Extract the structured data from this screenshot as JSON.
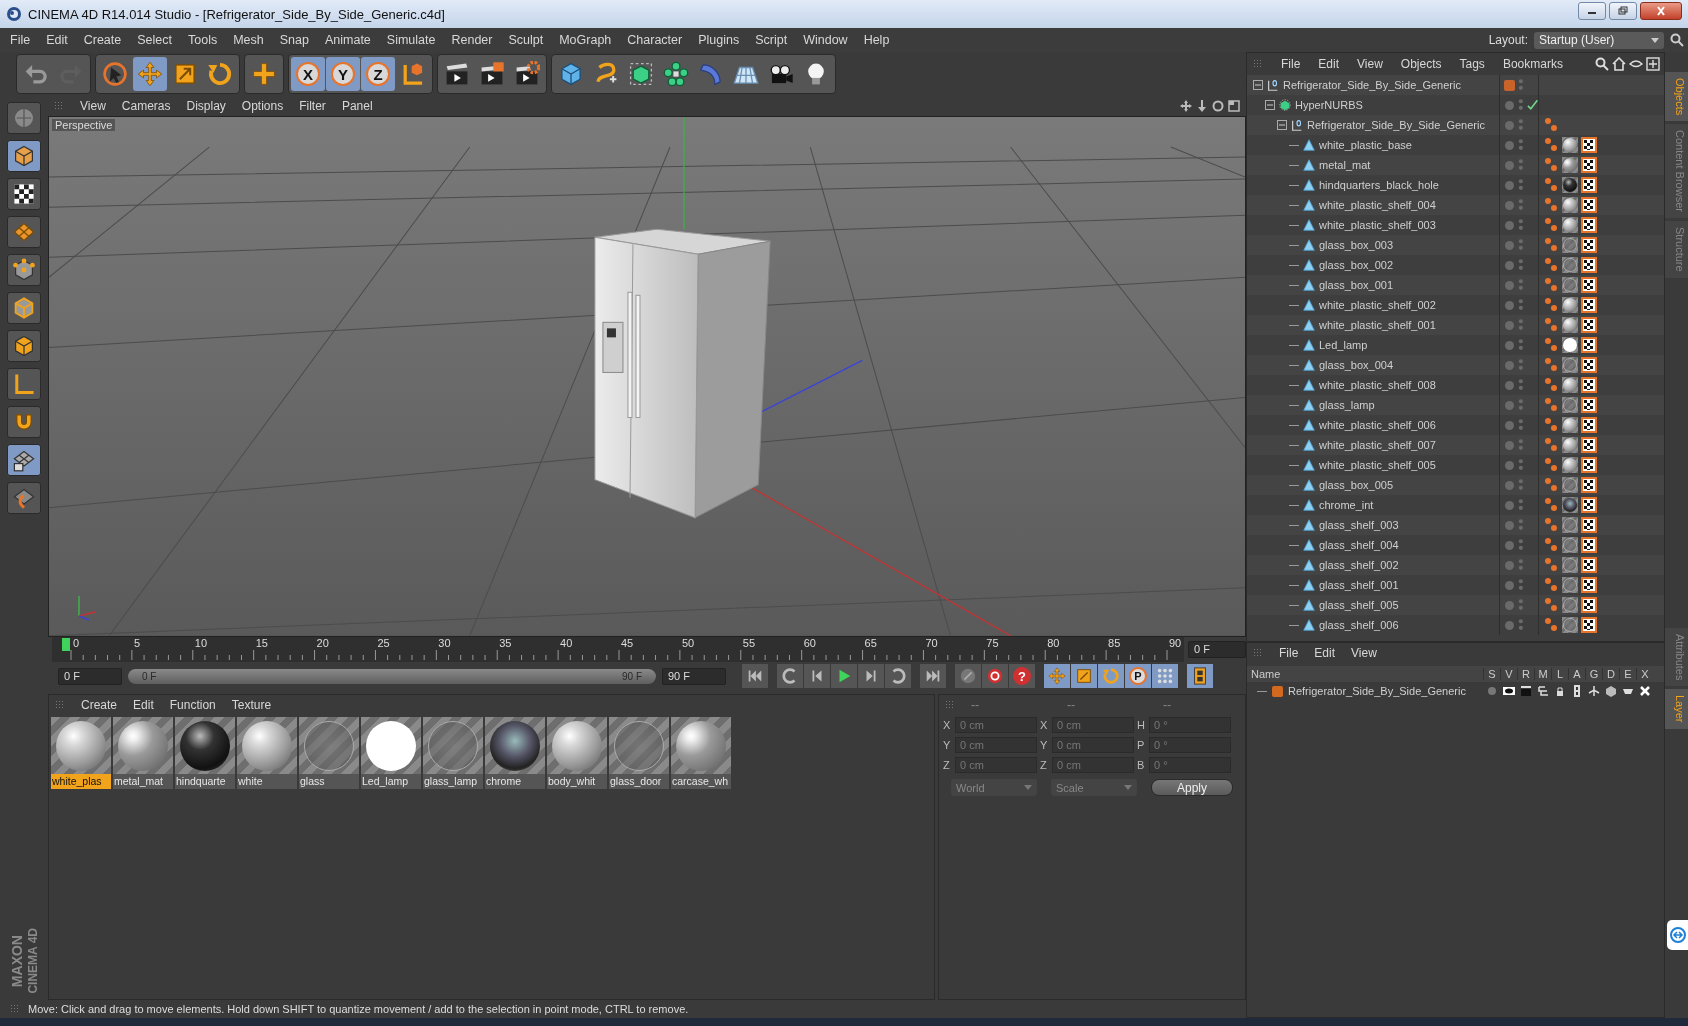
{
  "window": {
    "title": "CINEMA 4D R14.014 Studio - [Refrigerator_Side_By_Side_Generic.c4d]"
  },
  "menu": [
    "File",
    "Edit",
    "Create",
    "Select",
    "Tools",
    "Mesh",
    "Snap",
    "Animate",
    "Simulate",
    "Render",
    "Sculpt",
    "MoGraph",
    "Character",
    "Plugins",
    "Script",
    "Window",
    "Help"
  ],
  "layout": {
    "label": "Layout:",
    "value": "Startup (User)"
  },
  "toolbar": [
    [
      {
        "kind": "undo",
        "selected": false
      },
      {
        "kind": "redo",
        "selected": false
      }
    ],
    [
      {
        "kind": "select",
        "selected": false
      },
      {
        "kind": "move",
        "selected": true
      },
      {
        "kind": "scale",
        "selected": false
      },
      {
        "kind": "rotate",
        "selected": false
      }
    ],
    [
      {
        "kind": "add",
        "selected": false
      }
    ],
    [
      {
        "kind": "axis",
        "label": "X",
        "selected": true
      },
      {
        "kind": "axis",
        "label": "Y",
        "selected": true
      },
      {
        "kind": "axis",
        "label": "Z",
        "selected": true
      },
      {
        "kind": "world",
        "selected": false
      }
    ],
    [
      {
        "kind": "render-view",
        "selected": false
      },
      {
        "kind": "render-picture",
        "selected": false
      },
      {
        "kind": "render-settings",
        "selected": false
      }
    ],
    [
      {
        "kind": "cube",
        "selected": false
      },
      {
        "kind": "spline",
        "selected": false
      },
      {
        "kind": "nurbs",
        "selected": false
      },
      {
        "kind": "array",
        "selected": false
      },
      {
        "kind": "deformer",
        "selected": false
      },
      {
        "kind": "floor",
        "selected": false
      },
      {
        "kind": "camera",
        "selected": false
      },
      {
        "kind": "light",
        "selected": false
      }
    ]
  ],
  "left_toolbar": [
    {
      "kind": "model",
      "selected": false
    },
    {
      "kind": "object",
      "selected": true
    },
    {
      "kind": "texture",
      "selected": false
    },
    {
      "kind": "workplane",
      "selected": false
    },
    {
      "kind": "points",
      "selected": false
    },
    {
      "kind": "edges",
      "selected": false
    },
    {
      "kind": "polygons",
      "selected": false
    },
    {
      "kind": "axis-l",
      "selected": false
    },
    {
      "kind": "magnet",
      "selected": false
    },
    {
      "kind": "grid-lock",
      "selected": true
    },
    {
      "kind": "snap",
      "selected": false
    }
  ],
  "brand": [
    "MAXON",
    "CINEMA 4D"
  ],
  "viewport": {
    "menu": [
      "View",
      "Cameras",
      "Display",
      "Options",
      "Filter",
      "Panel"
    ],
    "view_name": "Perspective"
  },
  "timeline": {
    "ticks": [
      "0",
      "5",
      "10",
      "15",
      "20",
      "25",
      "30",
      "35",
      "40",
      "45",
      "50",
      "55",
      "60",
      "65",
      "70",
      "75",
      "80",
      "85",
      "90"
    ],
    "playhead": {
      "level": 0
    },
    "current_frame": "0 F"
  },
  "playback": {
    "start_field": "0 F",
    "range": {
      "start": "0 F",
      "end": "90 F",
      "level": 1
    },
    "end_field": "90 F",
    "buttons": [
      {
        "kind": "goto-start",
        "selected": false
      },
      {
        "kind": "record-key",
        "selected": false
      },
      {
        "kind": "prev",
        "selected": false
      },
      {
        "kind": "play",
        "selected": false
      },
      {
        "kind": "next",
        "selected": false
      },
      {
        "kind": "loop",
        "selected": false
      },
      {
        "kind": "goto-end",
        "selected": false
      },
      {
        "kind": "key-off",
        "selected": false
      },
      {
        "kind": "record",
        "selected": false
      },
      {
        "kind": "help",
        "label": "?",
        "selected": false
      },
      {
        "kind": "key-move",
        "selected": true
      },
      {
        "kind": "key-scale",
        "selected": true
      },
      {
        "kind": "key-rotate",
        "selected": true
      },
      {
        "kind": "key-param",
        "label": "P",
        "selected": true
      },
      {
        "kind": "key-points",
        "selected": true
      },
      {
        "kind": "timeline-film",
        "selected": true
      }
    ]
  },
  "materials": {
    "menu": [
      "Create",
      "Edit",
      "Function",
      "Texture"
    ],
    "items": [
      {
        "name": "white_plas",
        "kind": "plastic",
        "selected": true
      },
      {
        "name": "metal_mat",
        "kind": "metal",
        "selected": false
      },
      {
        "name": "hindquarte",
        "kind": "dark",
        "selected": false
      },
      {
        "name": "white",
        "kind": "plastic",
        "selected": false
      },
      {
        "name": "glass",
        "kind": "glass",
        "selected": false
      },
      {
        "name": "Led_lamp",
        "kind": "white",
        "selected": false
      },
      {
        "name": "glass_lamp",
        "kind": "glass",
        "selected": false
      },
      {
        "name": "chrome",
        "kind": "chrome",
        "selected": false
      },
      {
        "name": "body_whit",
        "kind": "plastic",
        "selected": false
      },
      {
        "name": "glass_door",
        "kind": "glass",
        "selected": false
      },
      {
        "name": "carcase_wh",
        "kind": "metal",
        "selected": false
      }
    ]
  },
  "coordinates": {
    "headers": [
      "--",
      "--",
      "--"
    ],
    "rows": [
      {
        "axis": "X",
        "position": "0 cm",
        "size_axis": "X",
        "size": "0 cm",
        "rotation_axis": "H",
        "rotation": "0 °"
      },
      {
        "axis": "Y",
        "position": "0 cm",
        "size_axis": "Y",
        "size": "0 cm",
        "rotation_axis": "P",
        "rotation": "0 °"
      },
      {
        "axis": "Z",
        "position": "0 cm",
        "size_axis": "Z",
        "size": "0 cm",
        "rotation_axis": "B",
        "rotation": "0 °"
      }
    ],
    "mode": "World",
    "size_mode": "Scale",
    "apply": "Apply"
  },
  "objects": {
    "menu": [
      "File",
      "Edit",
      "View",
      "Objects",
      "Tags",
      "Bookmarks"
    ],
    "tree": [
      {
        "name": "Refrigerator_Side_By_Side_Generic",
        "kind": "null",
        "color": "#c8642a",
        "children": [
          {
            "name": "HyperNURBS",
            "kind": "hypernurbs",
            "enabled": true,
            "children": [
              {
                "name": "Refrigerator_Side_By_Side_Generic",
                "kind": "null",
                "phong_tag": true,
                "children": [
                  {
                    "name": "white_plastic_base",
                    "kind": "mesh",
                    "phong_tag": true,
                    "material_tag": {
                      "kind": "plastic"
                    },
                    "uvw_tag": true
                  },
                  {
                    "name": "metal_mat",
                    "kind": "mesh",
                    "phong_tag": true,
                    "material_tag": {
                      "kind": "metal"
                    },
                    "uvw_tag": true
                  },
                  {
                    "name": "hindquarters_black_hole",
                    "kind": "mesh",
                    "phong_tag": true,
                    "material_tag": {
                      "kind": "dark"
                    },
                    "uvw_tag": true
                  },
                  {
                    "name": "white_plastic_shelf_004",
                    "kind": "mesh",
                    "phong_tag": true,
                    "material_tag": {
                      "kind": "plastic"
                    },
                    "uvw_tag": true
                  },
                  {
                    "name": "white_plastic_shelf_003",
                    "kind": "mesh",
                    "phong_tag": true,
                    "material_tag": {
                      "kind": "plastic"
                    },
                    "uvw_tag": true
                  },
                  {
                    "name": "glass_box_003",
                    "kind": "mesh",
                    "phong_tag": true,
                    "material_tag": {
                      "kind": "glass"
                    },
                    "uvw_tag": true
                  },
                  {
                    "name": "glass_box_002",
                    "kind": "mesh",
                    "phong_tag": true,
                    "material_tag": {
                      "kind": "glass"
                    },
                    "uvw_tag": true
                  },
                  {
                    "name": "glass_box_001",
                    "kind": "mesh",
                    "phong_tag": true,
                    "material_tag": {
                      "kind": "glass"
                    },
                    "uvw_tag": true
                  },
                  {
                    "name": "white_plastic_shelf_002",
                    "kind": "mesh",
                    "phong_tag": true,
                    "material_tag": {
                      "kind": "plastic"
                    },
                    "uvw_tag": true
                  },
                  {
                    "name": "white_plastic_shelf_001",
                    "kind": "mesh",
                    "phong_tag": true,
                    "material_tag": {
                      "kind": "plastic"
                    },
                    "uvw_tag": true
                  },
                  {
                    "name": "Led_lamp",
                    "kind": "mesh",
                    "phong_tag": true,
                    "material_tag": {
                      "kind": "white"
                    },
                    "uvw_tag": true
                  },
                  {
                    "name": "glass_box_004",
                    "kind": "mesh",
                    "phong_tag": true,
                    "material_tag": {
                      "kind": "glass"
                    },
                    "uvw_tag": true
                  },
                  {
                    "name": "white_plastic_shelf_008",
                    "kind": "mesh",
                    "phong_tag": true,
                    "material_tag": {
                      "kind": "plastic"
                    },
                    "uvw_tag": true
                  },
                  {
                    "name": "glass_lamp",
                    "kind": "mesh",
                    "phong_tag": true,
                    "material_tag": {
                      "kind": "glass"
                    },
                    "uvw_tag": true
                  },
                  {
                    "name": "white_plastic_shelf_006",
                    "kind": "mesh",
                    "phong_tag": true,
                    "material_tag": {
                      "kind": "plastic"
                    },
                    "uvw_tag": true
                  },
                  {
                    "name": "white_plastic_shelf_007",
                    "kind": "mesh",
                    "phong_tag": true,
                    "material_tag": {
                      "kind": "plastic"
                    },
                    "uvw_tag": true
                  },
                  {
                    "name": "white_plastic_shelf_005",
                    "kind": "mesh",
                    "phong_tag": true,
                    "material_tag": {
                      "kind": "plastic"
                    },
                    "uvw_tag": true
                  },
                  {
                    "name": "glass_box_005",
                    "kind": "mesh",
                    "phong_tag": true,
                    "material_tag": {
                      "kind": "glass"
                    },
                    "uvw_tag": true
                  },
                  {
                    "name": "chrome_int",
                    "kind": "mesh",
                    "phong_tag": true,
                    "material_tag": {
                      "kind": "chrome"
                    },
                    "uvw_tag": true
                  },
                  {
                    "name": "glass_shelf_003",
                    "kind": "mesh",
                    "phong_tag": true,
                    "material_tag": {
                      "kind": "glass"
                    },
                    "uvw_tag": true
                  },
                  {
                    "name": "glass_shelf_004",
                    "kind": "mesh",
                    "phong_tag": true,
                    "material_tag": {
                      "kind": "glass"
                    },
                    "uvw_tag": true
                  },
                  {
                    "name": "glass_shelf_002",
                    "kind": "mesh",
                    "phong_tag": true,
                    "material_tag": {
                      "kind": "glass"
                    },
                    "uvw_tag": true
                  },
                  {
                    "name": "glass_shelf_001",
                    "kind": "mesh",
                    "phong_tag": true,
                    "material_tag": {
                      "kind": "glass"
                    },
                    "uvw_tag": true
                  },
                  {
                    "name": "glass_shelf_005",
                    "kind": "mesh",
                    "phong_tag": true,
                    "material_tag": {
                      "kind": "glass"
                    },
                    "uvw_tag": true
                  },
                  {
                    "name": "glass_shelf_006",
                    "kind": "mesh",
                    "phong_tag": true,
                    "material_tag": {
                      "kind": "glass"
                    },
                    "uvw_tag": true
                  }
                ]
              }
            ]
          }
        ]
      }
    ]
  },
  "side_tabs_top": [
    {
      "label": "Objects",
      "selected": true
    },
    {
      "label": "Content Browser",
      "selected": false
    },
    {
      "label": "Structure",
      "selected": false
    }
  ],
  "layers": {
    "menu": [
      "File",
      "Edit",
      "View"
    ],
    "columns": [
      "Name",
      "S",
      "V",
      "R",
      "M",
      "L",
      "A",
      "G",
      "D",
      "E",
      "X"
    ],
    "rows": [
      {
        "name": "Refrigerator_Side_By_Side_Generic",
        "color": "#d2691e"
      }
    ]
  },
  "side_tabs_bottom": [
    {
      "label": "Attributes",
      "selected": false
    },
    {
      "label": "Layer",
      "selected": true
    }
  ],
  "status_bar": "Move: Click and drag to move elements. Hold down SHIFT to quantize movement / add to the selection in point mode, CTRL to remove."
}
